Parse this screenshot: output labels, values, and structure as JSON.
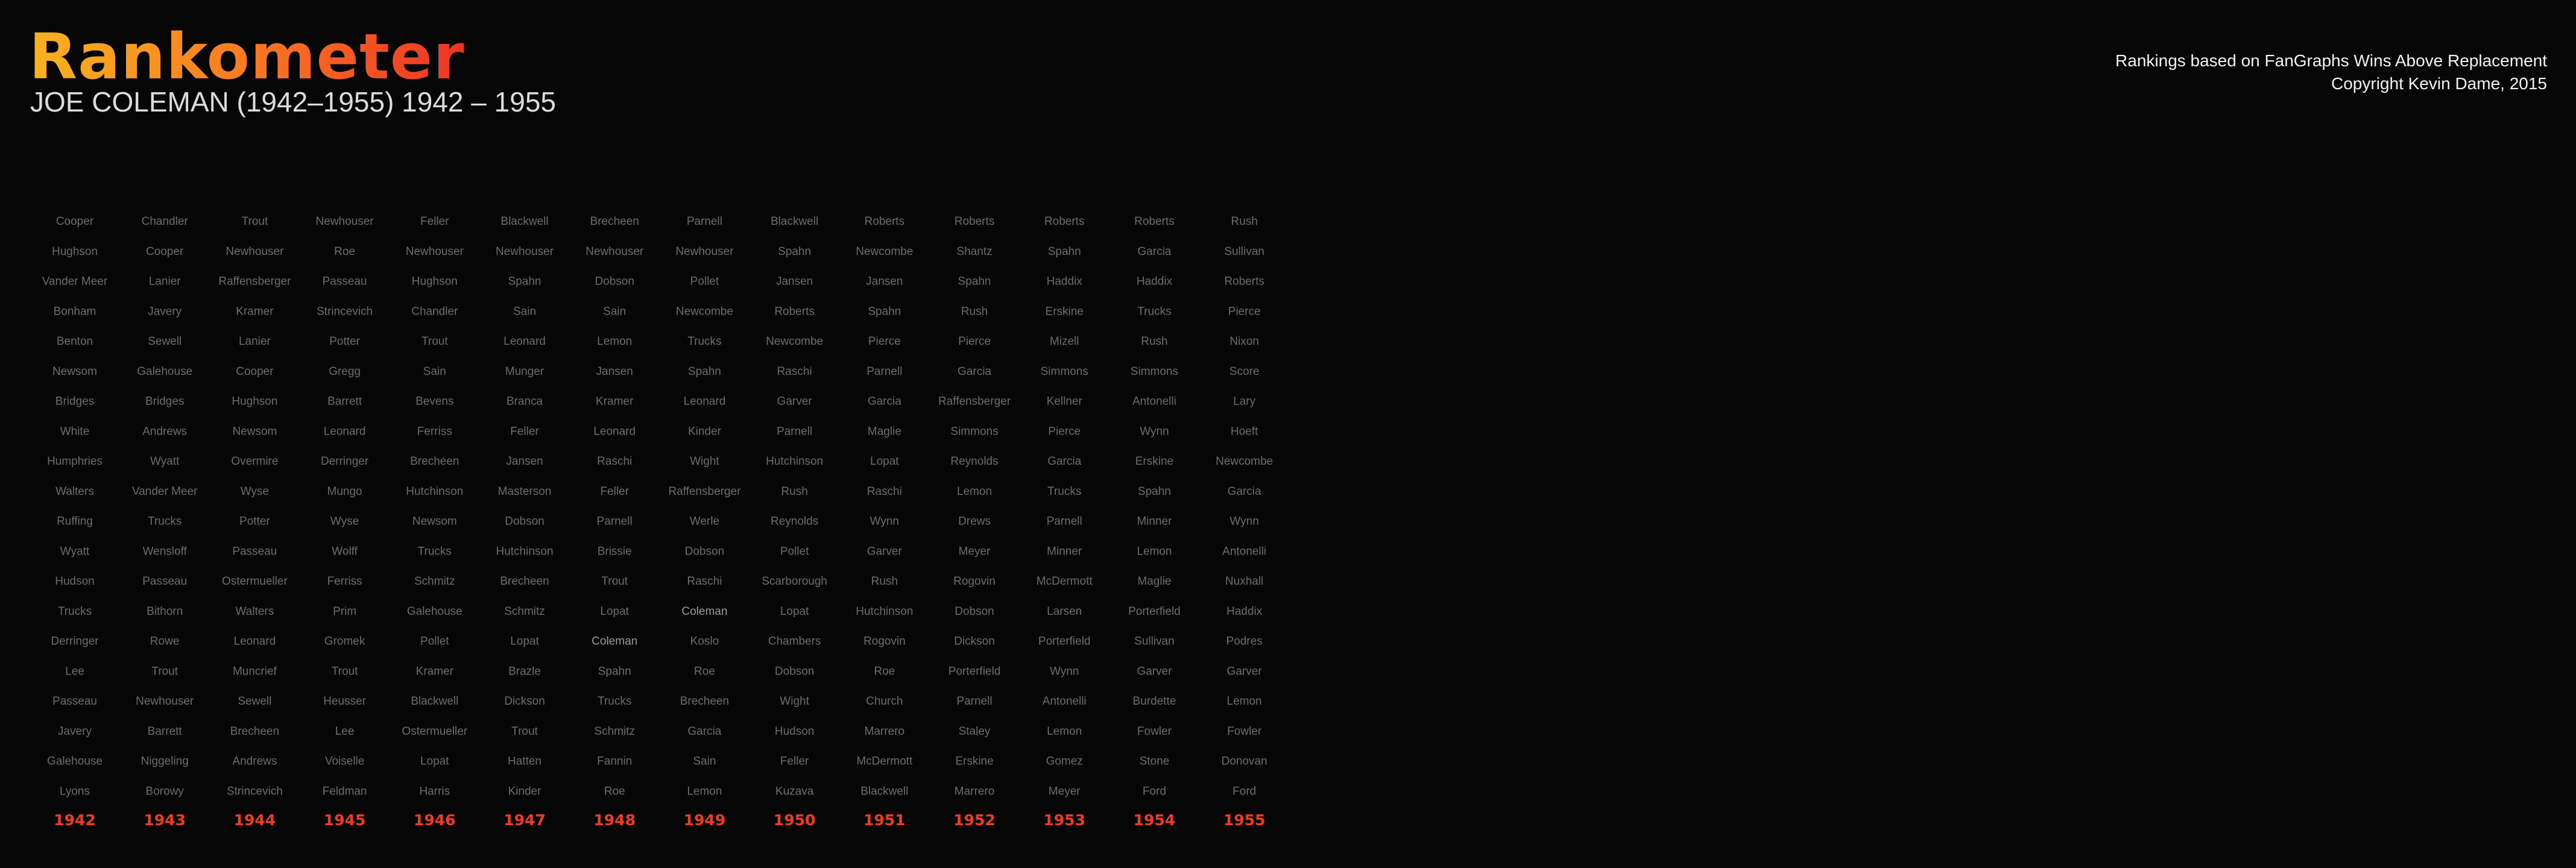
{
  "header": {
    "title": "Rankometer",
    "subtitle": "JOE COLEMAN (1942–1955) 1942 – 1955",
    "credit_line_1": "Rankings based on FanGraphs Wins Above Replacement",
    "credit_line_2": "Copyright Kevin Dame, 2015"
  },
  "colors": {
    "title_gradient": [
      "#f9b320",
      "#f77a22",
      "#ee3324"
    ],
    "background": "#060606",
    "name_text": "#6c6c6c",
    "year_text": "#ee3b24"
  },
  "chart_data": {
    "type": "table",
    "title": "Rankometer",
    "subtitle": "JOE COLEMAN (1942–1955) 1942 – 1955",
    "highlighted_player": "Coleman",
    "columns": [
      {
        "year": "1942",
        "names": [
          "Cooper",
          "Hughson",
          "Vander Meer",
          "Bonham",
          "Benton",
          "Newsom",
          "Bridges",
          "White",
          "Humphries",
          "Walters",
          "Ruffing",
          "Wyatt",
          "Hudson",
          "Trucks",
          "Derringer",
          "Lee",
          "Passeau",
          "Javery",
          "Galehouse",
          "Lyons"
        ]
      },
      {
        "year": "1943",
        "names": [
          "Chandler",
          "Cooper",
          "Lanier",
          "Javery",
          "Sewell",
          "Galehouse",
          "Bridges",
          "Andrews",
          "Wyatt",
          "Vander Meer",
          "Trucks",
          "Wensloff",
          "Passeau",
          "Bithorn",
          "Rowe",
          "Trout",
          "Newhouser",
          "Barrett",
          "Niggeling",
          "Borowy"
        ]
      },
      {
        "year": "1944",
        "names": [
          "Trout",
          "Newhouser",
          "Raffensberger",
          "Kramer",
          "Lanier",
          "Cooper",
          "Hughson",
          "Newsom",
          "Overmire",
          "Wyse",
          "Potter",
          "Passeau",
          "Ostermueller",
          "Walters",
          "Leonard",
          "Muncrief",
          "Sewell",
          "Brecheen",
          "Andrews",
          "Strincevich"
        ]
      },
      {
        "year": "1945",
        "names": [
          "Newhouser",
          "Roe",
          "Passeau",
          "Strincevich",
          "Potter",
          "Gregg",
          "Barrett",
          "Leonard",
          "Derringer",
          "Mungo",
          "Wyse",
          "Wolff",
          "Ferriss",
          "Prim",
          "Gromek",
          "Trout",
          "Heusser",
          "Lee",
          "Voiselle",
          "Feldman"
        ]
      },
      {
        "year": "1946",
        "names": [
          "Feller",
          "Newhouser",
          "Hughson",
          "Chandler",
          "Trout",
          "Sain",
          "Bevens",
          "Ferriss",
          "Brecheen",
          "Hutchinson",
          "Newsom",
          "Trucks",
          "Schmitz",
          "Galehouse",
          "Pollet",
          "Kramer",
          "Blackwell",
          "Ostermueller",
          "Lopat",
          "Harris"
        ]
      },
      {
        "year": "1947",
        "names": [
          "Blackwell",
          "Newhouser",
          "Spahn",
          "Sain",
          "Leonard",
          "Munger",
          "Branca",
          "Feller",
          "Jansen",
          "Masterson",
          "Dobson",
          "Hutchinson",
          "Brecheen",
          "Schmitz",
          "Lopat",
          "Brazle",
          "Dickson",
          "Trout",
          "Hatten",
          "Kinder"
        ]
      },
      {
        "year": "1948",
        "names": [
          "Brecheen",
          "Newhouser",
          "Dobson",
          "Sain",
          "Lemon",
          "Jansen",
          "Kramer",
          "Leonard",
          "Raschi",
          "Feller",
          "Parnell",
          "Brissie",
          "Trout",
          "Lopat",
          "Coleman",
          "Spahn",
          "Trucks",
          "Schmitz",
          "Fannin",
          "Roe"
        ]
      },
      {
        "year": "1949",
        "names": [
          "Parnell",
          "Newhouser",
          "Pollet",
          "Newcombe",
          "Trucks",
          "Spahn",
          "Leonard",
          "Kinder",
          "Wight",
          "Raffensberger",
          "Werle",
          "Dobson",
          "Raschi",
          "Coleman",
          "Koslo",
          "Roe",
          "Brecheen",
          "Garcia",
          "Sain",
          "Lemon"
        ]
      },
      {
        "year": "1950",
        "names": [
          "Blackwell",
          "Spahn",
          "Jansen",
          "Roberts",
          "Newcombe",
          "Raschi",
          "Garver",
          "Parnell",
          "Hutchinson",
          "Rush",
          "Reynolds",
          "Pollet",
          "Scarborough",
          "Lopat",
          "Chambers",
          "Dobson",
          "Wight",
          "Hudson",
          "Feller",
          "Kuzava"
        ]
      },
      {
        "year": "1951",
        "names": [
          "Roberts",
          "Newcombe",
          "Jansen",
          "Spahn",
          "Pierce",
          "Parnell",
          "Garcia",
          "Maglie",
          "Lopat",
          "Raschi",
          "Wynn",
          "Garver",
          "Rush",
          "Hutchinson",
          "Rogovin",
          "Roe",
          "Church",
          "Marrero",
          "McDermott",
          "Blackwell"
        ]
      },
      {
        "year": "1952",
        "names": [
          "Roberts",
          "Shantz",
          "Spahn",
          "Rush",
          "Pierce",
          "Garcia",
          "Raffensberger",
          "Simmons",
          "Reynolds",
          "Lemon",
          "Drews",
          "Meyer",
          "Rogovin",
          "Dobson",
          "Dickson",
          "Porterfield",
          "Parnell",
          "Staley",
          "Erskine",
          "Marrero"
        ]
      },
      {
        "year": "1953",
        "names": [
          "Roberts",
          "Spahn",
          "Haddix",
          "Erskine",
          "Mizell",
          "Simmons",
          "Kellner",
          "Pierce",
          "Garcia",
          "Trucks",
          "Parnell",
          "Minner",
          "McDermott",
          "Larsen",
          "Porterfield",
          "Wynn",
          "Antonelli",
          "Lemon",
          "Gomez",
          "Meyer"
        ]
      },
      {
        "year": "1954",
        "names": [
          "Roberts",
          "Garcia",
          "Haddix",
          "Trucks",
          "Rush",
          "Simmons",
          "Antonelli",
          "Wynn",
          "Erskine",
          "Spahn",
          "Minner",
          "Lemon",
          "Maglie",
          "Porterfield",
          "Sullivan",
          "Garver",
          "Burdette",
          "Fowler",
          "Stone",
          "Ford"
        ]
      },
      {
        "year": "1955",
        "names": [
          "Rush",
          "Sullivan",
          "Roberts",
          "Pierce",
          "Nixon",
          "Score",
          "Lary",
          "Hoeft",
          "Newcombe",
          "Garcia",
          "Wynn",
          "Antonelli",
          "Nuxhall",
          "Haddix",
          "Podres",
          "Garver",
          "Lemon",
          "Fowler",
          "Donovan",
          "Ford"
        ]
      }
    ]
  }
}
